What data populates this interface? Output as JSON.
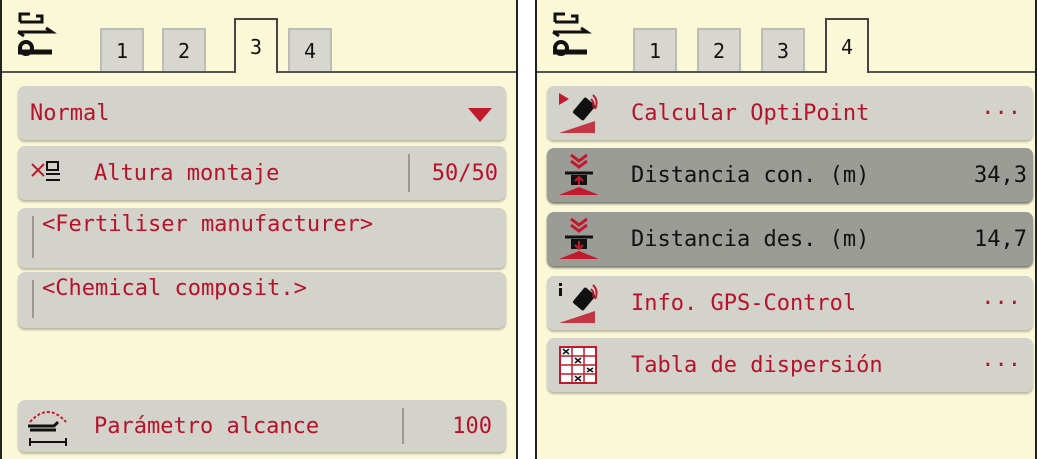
{
  "left_panel": {
    "tabs": [
      "1",
      "2",
      "3",
      "4"
    ],
    "active_tab": "3",
    "dropdown": {
      "value": "Normal",
      "icon": "dropdown-arrow-icon"
    },
    "mounting_height": {
      "label": "Altura montaje",
      "value": "50/50",
      "icon": "mounting-height-icon"
    },
    "fertiliser_manufacturer": {
      "value": "<Fertiliser manufacturer>"
    },
    "chemical_composition": {
      "value": "<Chemical composit.>"
    },
    "range_parameter": {
      "label": "Parámetro alcance",
      "value": "100",
      "icon": "throw-range-icon"
    }
  },
  "right_panel": {
    "tabs": [
      "1",
      "2",
      "3",
      "4"
    ],
    "active_tab": "4",
    "items": [
      {
        "label": "Calcular OptiPoint",
        "value": "···",
        "icon": "optipoint-gps-icon"
      },
      {
        "label": "Distancia con. (m)",
        "value": "34,3",
        "icon": "switch-on-distance-icon"
      },
      {
        "label": "Distancia des. (m)",
        "value": "14,7",
        "icon": "switch-off-distance-icon"
      },
      {
        "label": "Info. GPS-Control",
        "value": "···",
        "icon": "gps-info-icon"
      },
      {
        "label": "Tabla de dispersión",
        "value": "···",
        "icon": "spread-chart-icon"
      }
    ]
  },
  "colors": {
    "background": "#fbf8d8",
    "button": "#d3d3cc",
    "button_selected": "#9c9c97",
    "text_accent": "#b8122a"
  }
}
